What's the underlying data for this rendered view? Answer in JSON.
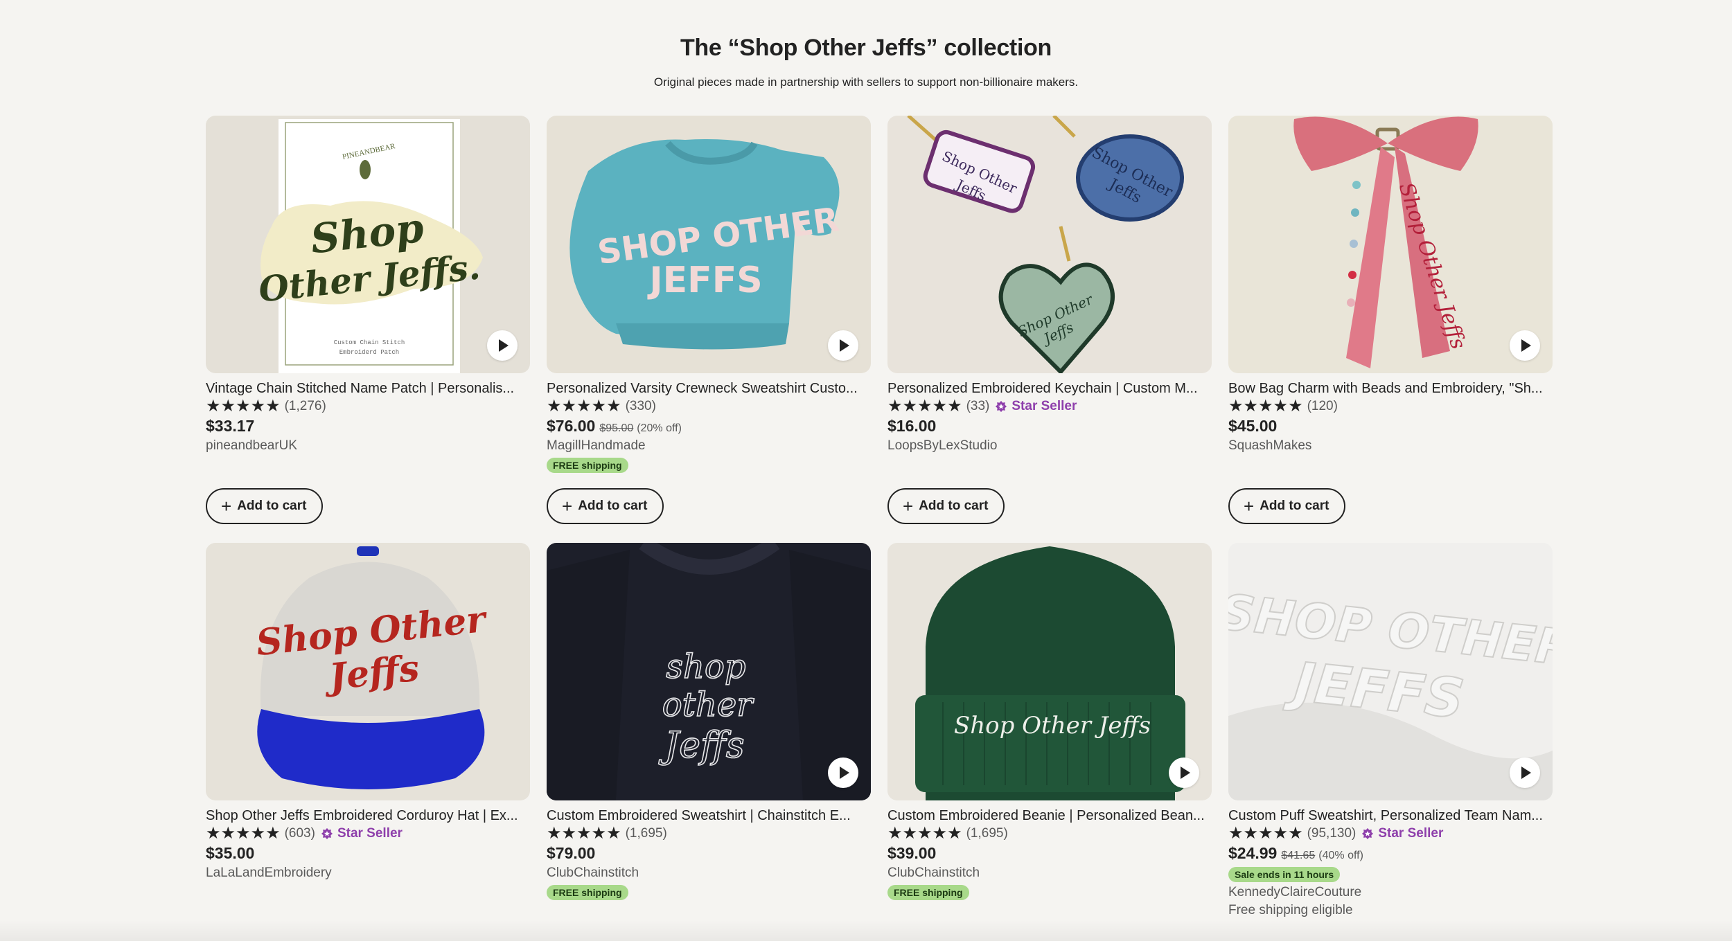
{
  "header": {
    "title": "The “Shop Other Jeffs” collection",
    "subtitle": "Original pieces made in partnership with sellers to support non-billionaire makers."
  },
  "colors": {
    "background": "#f5f4f1",
    "star_seller": "#8e3fab",
    "shipping_badge": "#a8d98a"
  },
  "add_to_cart_label": "Add to cart",
  "listings": [
    {
      "title": "Vintage Chain Stitched Name Patch | Personalis...",
      "stars": "★★★★★",
      "review_count": "(1,276)",
      "price": "$33.17",
      "shop": "pineandbearUK",
      "image": "name-patch-image"
    },
    {
      "title": "Personalized Varsity Crewneck Sweatshirt Custo...",
      "stars": "★★★★★",
      "review_count": "(330)",
      "price": "$76.00",
      "original_price": "$95.00",
      "discount": "(20% off)",
      "shop": "MagillHandmade",
      "badge": "FREE shipping",
      "image": "varsity-sweatshirt-image"
    },
    {
      "title": "Personalized Embroidered Keychain | Custom M...",
      "stars": "★★★★★",
      "review_count": "(33)",
      "star_seller": "Star Seller",
      "price": "$16.00",
      "shop": "LoopsByLexStudio",
      "image": "keychain-image"
    },
    {
      "title": "Bow Bag Charm with Beads and Embroidery, \"Sh...",
      "stars": "★★★★★",
      "review_count": "(120)",
      "price": "$45.00",
      "shop": "SquashMakes",
      "image": "bow-charm-image"
    },
    {
      "title": "Shop Other Jeffs Embroidered Corduroy Hat | Ex...",
      "stars": "★★★★★",
      "review_count": "(603)",
      "star_seller": "Star Seller",
      "price": "$35.00",
      "shop": "LaLaLandEmbroidery",
      "image": "corduroy-hat-image"
    },
    {
      "title": "Custom Embroidered Sweatshirt | Chainstitch E...",
      "stars": "★★★★★",
      "review_count": "(1,695)",
      "price": "$79.00",
      "shop": "ClubChainstitch",
      "badge": "FREE shipping",
      "image": "chainstitch-sweatshirt-image"
    },
    {
      "title": "Custom Embroidered Beanie | Personalized Bean...",
      "stars": "★★★★★",
      "review_count": "(1,695)",
      "price": "$39.00",
      "shop": "ClubChainstitch",
      "badge": "FREE shipping",
      "image": "beanie-image"
    },
    {
      "title": "Custom Puff Sweatshirt, Personalized Team Nam...",
      "stars": "★★★★★",
      "review_count": "(95,130)",
      "star_seller": "Star Seller",
      "price": "$24.99",
      "original_price": "$41.65",
      "discount": "(40% off)",
      "sale_badge": "Sale ends in 11 hours",
      "shop": "KennedyClaireCouture",
      "shipping_note": "Free shipping eligible",
      "image": "puff-sweatshirt-image"
    }
  ],
  "artwork_text": {
    "patch_brand": "PINEANDBEAR",
    "patch_line1": "Shop",
    "patch_line2": "Other Jeffs.",
    "patch_caption1": "Custom Chain Stitch",
    "patch_caption2": "Embroiderd Patch",
    "varsity_line1": "SHOP OTHER",
    "varsity_line2": "JEFFS",
    "keychain_line1": "Shop Other",
    "keychain_line2": "Jeffs",
    "bow_text": "Shop Other Jeffs",
    "hat_line1": "Shop Other",
    "hat_line2": "Jeffs",
    "chain_line1": "shop",
    "chain_line2": "other",
    "chain_line3": "Jeffs",
    "beanie_text": "Shop Other Jeffs",
    "puff_line1": "SHOP OTHER",
    "puff_line2": "JEFFS"
  }
}
